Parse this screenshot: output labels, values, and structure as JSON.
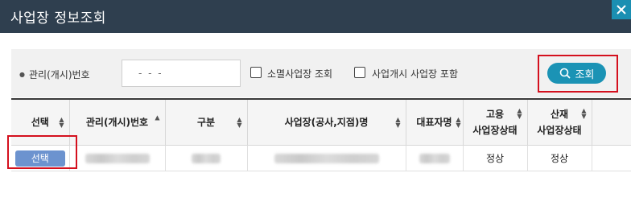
{
  "window": {
    "title": "사업장 정보조회",
    "close_icon": "close-icon"
  },
  "search": {
    "mgmt_label": "관리(개시)번호",
    "mgmt_value": "- - -",
    "closed_label": "소멸사업장 조회",
    "include_label": "사업개시 사업장 포함",
    "search_button": "조회"
  },
  "table": {
    "headers": {
      "select": "선택",
      "mgmt_no": "관리(개시)번호",
      "type": "구분",
      "name": "사업장(공사,지점)명",
      "rep": "대표자명",
      "emp_1": "고용",
      "emp_2": "사업장상태",
      "ind_1": "산재",
      "ind_2": "사업장상태"
    },
    "row": {
      "select_button": "선택",
      "employment_status": "정상",
      "industrial_status": "정상"
    }
  },
  "colors": {
    "titlebar": "#2f3f4f",
    "accent": "#1b93b5",
    "highlight": "#d4101e",
    "select_button": "#6c93cf"
  }
}
